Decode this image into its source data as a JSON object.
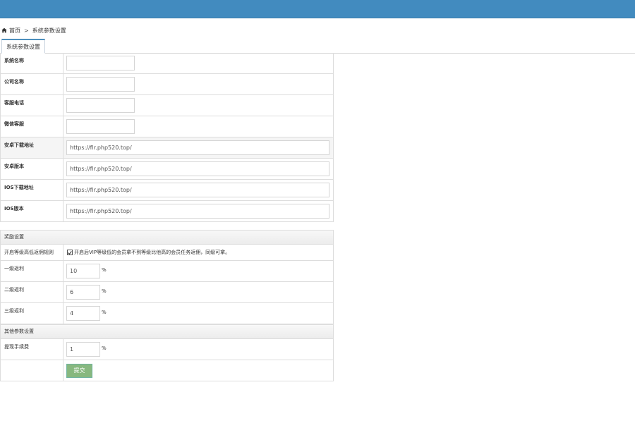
{
  "breadcrumb": {
    "home": "首页",
    "separator": ">",
    "current": "系统参数设置"
  },
  "tab": {
    "label": "系统参数设置"
  },
  "basic": [
    {
      "label": "系统名称",
      "value": ""
    },
    {
      "label": "公司名称",
      "value": ""
    },
    {
      "label": "客服电话",
      "value": ""
    },
    {
      "label": "微信客服",
      "value": ""
    },
    {
      "label": "安卓下载地址",
      "value": "https://fir.php520.top/"
    },
    {
      "label": "安卓版本",
      "value": "https://fir.php520.top/"
    },
    {
      "label": "IOS下载地址",
      "value": "https://fir.php520.top/"
    },
    {
      "label": "IOS版本",
      "value": "https://fir.php520.top/"
    }
  ],
  "reward": {
    "title": "奖励设置",
    "rule_label": "开启等级高低返佣规则",
    "rule_text": "开启后VIP等级低的会员拿不到等级比他高的会员任务返佣，同级可拿。",
    "rule_checked": true,
    "levels": [
      {
        "label": "一级返利",
        "value": "10",
        "unit": "%"
      },
      {
        "label": "二级返利",
        "value": "6",
        "unit": "%"
      },
      {
        "label": "三级返利",
        "value": "4",
        "unit": "%"
      }
    ]
  },
  "other": {
    "title": "其他参数设置",
    "fee_label": "提现手续费",
    "fee_value": "1",
    "fee_unit": "%"
  },
  "submit_label": "提交",
  "colors": {
    "topbar": "#428bbf",
    "submit": "#87b87f",
    "tab_accent": "#4c8fbd"
  }
}
